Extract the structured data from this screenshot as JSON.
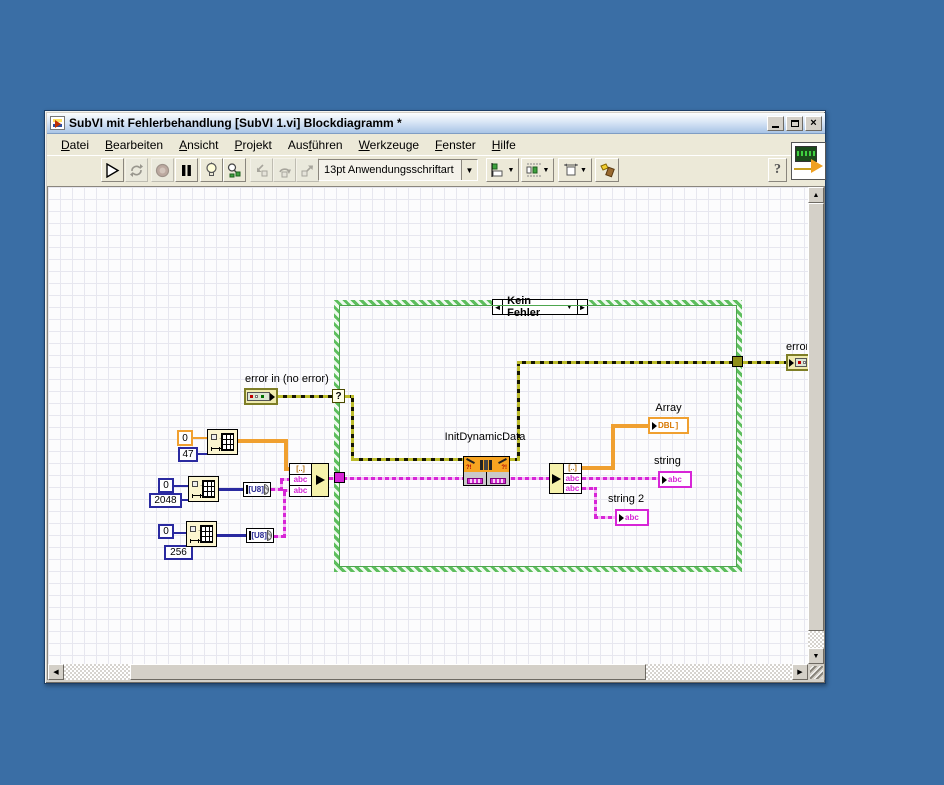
{
  "window": {
    "title": "SubVI mit Fehlerbehandlung [SubVI 1.vi] Blockdiagramm *",
    "controls": {
      "minimize": "_",
      "maximize": "□",
      "close": "X"
    }
  },
  "menubar": {
    "items": [
      {
        "label": "Datei",
        "accel": 0
      },
      {
        "label": "Bearbeiten",
        "accel": 0
      },
      {
        "label": "Ansicht",
        "accel": 0
      },
      {
        "label": "Projekt",
        "accel": 0
      },
      {
        "label": "Ausführen",
        "accel": 3
      },
      {
        "label": "Werkzeuge",
        "accel": 0
      },
      {
        "label": "Fenster",
        "accel": 0
      },
      {
        "label": "Hilfe",
        "accel": 0
      }
    ]
  },
  "toolbar": {
    "font_selector": "13pt Anwendungsschriftart",
    "help_label": "?"
  },
  "diagram": {
    "case_structure": {
      "selected_case": "Kein Fehler",
      "prev_glyph": "◄",
      "next_glyph": "►",
      "dd_glyph": "▼",
      "selector_glyph": "?"
    },
    "labels": {
      "error_in": "error in (no error)",
      "error_out": "error out",
      "init_dynamic_data": "InitDynamicData",
      "array": "Array",
      "string": "string",
      "string2": "string 2"
    },
    "nodes": {
      "init_dd_warn": "?!",
      "u8_text": "[U8]",
      "cluster_row": "[..]",
      "string_row": "abc"
    },
    "indicators": {
      "array_type": "DBL",
      "string_type": "abc",
      "string2_type": "abc"
    },
    "constants": [
      {
        "value": "0",
        "type": "dbl"
      },
      {
        "value": "47",
        "type": "int"
      },
      {
        "value": "0",
        "type": "int"
      },
      {
        "value": "2048",
        "type": "int"
      },
      {
        "value": "0",
        "type": "int"
      },
      {
        "value": "256",
        "type": "int"
      }
    ]
  },
  "colors": {
    "desktop_bg": "#3A6EA5",
    "error_wire": "#BCBC2A",
    "string_wire": "#D726D7",
    "dbl_orange": "#F0A030",
    "int_blue": "#2A2AA0",
    "express_orange": "#F7A421",
    "case_green": "#5DBE5D"
  }
}
